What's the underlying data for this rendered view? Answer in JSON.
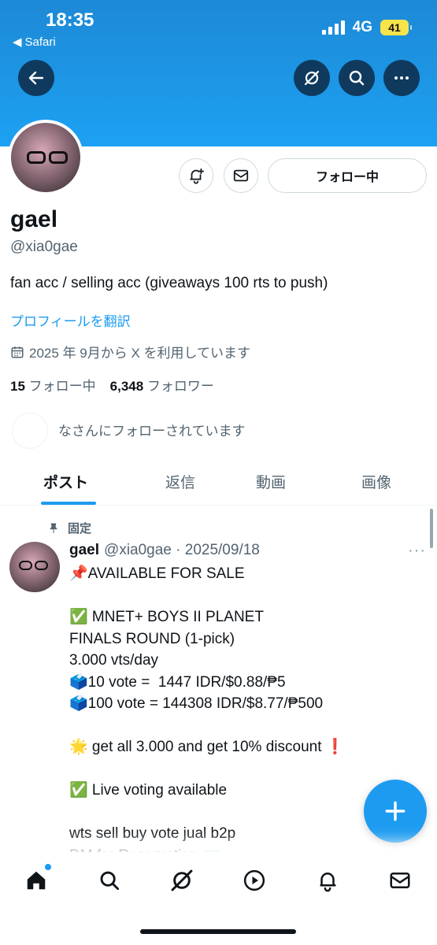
{
  "status_bar": {
    "time": "18:35",
    "back_app": "Safari",
    "network": "4G",
    "battery": "41"
  },
  "header": {
    "back_icon": "arrow-left-icon",
    "grok_icon": "grok-icon",
    "search_icon": "search-icon",
    "more_icon": "more-horizontal-icon"
  },
  "profile": {
    "name": "gael",
    "handle": "@xia0gae",
    "bio": "fan acc / selling acc (giveaways 100 rts to push)",
    "translate_link": "プロフィールを翻訳",
    "joined": "2025 年 9月から X を利用しています",
    "following_count": "15",
    "following_label": "フォロー中",
    "followers_count": "6,348",
    "followers_label": "フォロワー",
    "known_followers": "なさんにフォローされています",
    "follow_button": "フォロー中"
  },
  "tabs": [
    {
      "label": "ポスト",
      "active": true
    },
    {
      "label": "返信",
      "active": false
    },
    {
      "label": "動画",
      "active": false
    },
    {
      "label": "画像",
      "active": false
    }
  ],
  "post": {
    "pinned_label": "固定",
    "author_name": "gael",
    "author_meta": "@xia0gae · 2025/09/18",
    "more": "···",
    "body": "📌AVAILABLE FOR SALE\n\n✅ MNET+ BOYS II PLANET\nFINALS ROUND (1-pick)\n3.000 vts/day\n🗳️10 vote =  1447 IDR/$0.88/₱5\n🗳️100 vote = 144308 IDR/$8.77/₱500\n\n🌟 get all 3.000 and get 10% discount ❗\n\n✅ Live voting available\n\nwts sell buy vote jual b2p\nDM for Reservation 📨"
  },
  "fab": {
    "label": "+"
  },
  "bottom_nav": [
    {
      "name": "home",
      "icon": "home-icon",
      "has_dot": true
    },
    {
      "name": "search",
      "icon": "search-icon",
      "has_dot": false
    },
    {
      "name": "grok",
      "icon": "grok-icon",
      "has_dot": false
    },
    {
      "name": "video",
      "icon": "play-icon",
      "has_dot": false
    },
    {
      "name": "notifications",
      "icon": "bell-icon",
      "has_dot": false
    },
    {
      "name": "messages",
      "icon": "mail-icon",
      "has_dot": false
    }
  ],
  "colors": {
    "accent": "#1d9bf0",
    "banner": "#1da1f2",
    "text_secondary": "#536471"
  }
}
